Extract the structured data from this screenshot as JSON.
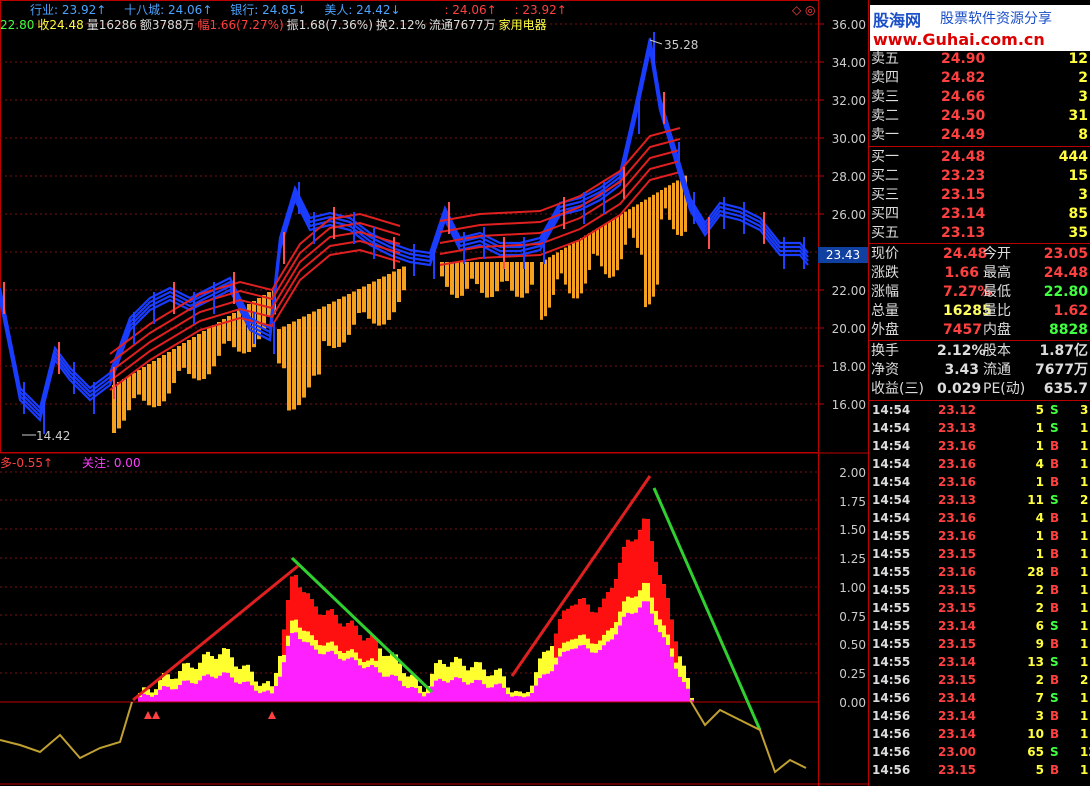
{
  "header": {
    "row1": [
      "行业: 23.92↑",
      "十八城: 24.06↑",
      "银行: 24.85↓",
      "美人: 24.42↓",
      ": 24.06↑",
      ": 23.92↑"
    ],
    "open_label": "22.80",
    "close_label": "收24.48",
    "vol_label": "量16286",
    "amount_label": "额3788万",
    "change_label": "幅1.66(7.27%)",
    "amp_label": "振1.68(7.36%)",
    "turnover_label": "换2.12%",
    "float_label": "流通7677万",
    "industry_label": "家用电器",
    "indicator_name": "多-0.55↑",
    "indicator_focus": "关注: 0.00",
    "corner_icons": "◇ ◎"
  },
  "price_axis": [
    "36.00",
    "34.00",
    "32.00",
    "30.00",
    "28.00",
    "26.00",
    "22.00",
    "20.00",
    "18.00",
    "16.00"
  ],
  "current_price_tag": "23.43",
  "high_marker": "35.28",
  "low_marker": "14.42",
  "ind_axis": [
    "2.00",
    "1.75",
    "1.50",
    "1.25",
    "1.00",
    "0.75",
    "0.50",
    "0.25",
    "0.00"
  ],
  "logo": {
    "name": "股海网",
    "slogan": "股票软件资源分享",
    "url": "www.Guhai.com.cn"
  },
  "orderbook": {
    "asks": [
      {
        "label": "卖五",
        "price": "24.90",
        "vol": "12"
      },
      {
        "label": "卖四",
        "price": "24.82",
        "vol": "2"
      },
      {
        "label": "卖三",
        "price": "24.66",
        "vol": "3"
      },
      {
        "label": "卖二",
        "price": "24.50",
        "vol": "31"
      },
      {
        "label": "卖一",
        "price": "24.49",
        "vol": "8"
      }
    ],
    "bids": [
      {
        "label": "买一",
        "price": "24.48",
        "vol": "444"
      },
      {
        "label": "买二",
        "price": "23.23",
        "vol": "15"
      },
      {
        "label": "买三",
        "price": "23.15",
        "vol": "3"
      },
      {
        "label": "买四",
        "price": "23.14",
        "vol": "85"
      },
      {
        "label": "买五",
        "price": "23.13",
        "vol": "35"
      }
    ]
  },
  "quote": [
    {
      "l1": "现价",
      "v1": "24.48",
      "l2": "今开",
      "v2": "23.05",
      "c1": "#ff4040",
      "c2": "#ff4040"
    },
    {
      "l1": "涨跌",
      "v1": "1.66",
      "l2": "最高",
      "v2": "24.48",
      "c1": "#ff4040",
      "c2": "#ff4040"
    },
    {
      "l1": "涨幅",
      "v1": "7.27%",
      "l2": "最低",
      "v2": "22.80",
      "c1": "#ff4040",
      "c2": "#40ff40"
    },
    {
      "l1": "总量",
      "v1": "16285",
      "l2": "量比",
      "v2": "1.62",
      "c1": "#ffff60",
      "c2": "#ff4040"
    },
    {
      "l1": "外盘",
      "v1": "7457",
      "l2": "内盘",
      "v2": "8828",
      "c1": "#ff4040",
      "c2": "#40ff40"
    }
  ],
  "fund": [
    {
      "l1": "换手",
      "v1": "2.12%",
      "l2": "股本",
      "v2": "1.87亿"
    },
    {
      "l1": "净资",
      "v1": "3.43",
      "l2": "流通",
      "v2": "7677万"
    },
    {
      "l1": "收益(三)",
      "v1": "0.029",
      "l2": "PE(动)",
      "v2": "635.7"
    }
  ],
  "ticks": [
    {
      "t": "14:54",
      "p": "23.12",
      "v": "5",
      "s": "S",
      "n": "3"
    },
    {
      "t": "14:54",
      "p": "23.13",
      "v": "1",
      "s": "S",
      "n": "1"
    },
    {
      "t": "14:54",
      "p": "23.16",
      "v": "1",
      "s": "B",
      "n": "1"
    },
    {
      "t": "14:54",
      "p": "23.16",
      "v": "4",
      "s": "B",
      "n": "1"
    },
    {
      "t": "14:54",
      "p": "23.16",
      "v": "1",
      "s": "B",
      "n": "1"
    },
    {
      "t": "14:54",
      "p": "23.13",
      "v": "11",
      "s": "S",
      "n": "2"
    },
    {
      "t": "14:54",
      "p": "23.16",
      "v": "4",
      "s": "B",
      "n": "1"
    },
    {
      "t": "14:55",
      "p": "23.16",
      "v": "1",
      "s": "B",
      "n": "1"
    },
    {
      "t": "14:55",
      "p": "23.15",
      "v": "1",
      "s": "B",
      "n": "1"
    },
    {
      "t": "14:55",
      "p": "23.16",
      "v": "28",
      "s": "B",
      "n": "1"
    },
    {
      "t": "14:55",
      "p": "23.15",
      "v": "2",
      "s": "B",
      "n": "1"
    },
    {
      "t": "14:55",
      "p": "23.15",
      "v": "2",
      "s": "B",
      "n": "1"
    },
    {
      "t": "14:55",
      "p": "23.14",
      "v": "6",
      "s": "S",
      "n": "1"
    },
    {
      "t": "14:55",
      "p": "23.15",
      "v": "9",
      "s": "B",
      "n": "1"
    },
    {
      "t": "14:55",
      "p": "23.14",
      "v": "13",
      "s": "S",
      "n": "1"
    },
    {
      "t": "14:56",
      "p": "23.15",
      "v": "2",
      "s": "B",
      "n": "2"
    },
    {
      "t": "14:56",
      "p": "23.14",
      "v": "7",
      "s": "S",
      "n": "1"
    },
    {
      "t": "14:56",
      "p": "23.14",
      "v": "3",
      "s": "B",
      "n": "1"
    },
    {
      "t": "14:56",
      "p": "23.14",
      "v": "10",
      "s": "B",
      "n": "1"
    },
    {
      "t": "14:56",
      "p": "23.00",
      "v": "65",
      "s": "S",
      "n": "12"
    },
    {
      "t": "14:56",
      "p": "23.15",
      "v": "5",
      "s": "B",
      "n": "1"
    }
  ]
}
